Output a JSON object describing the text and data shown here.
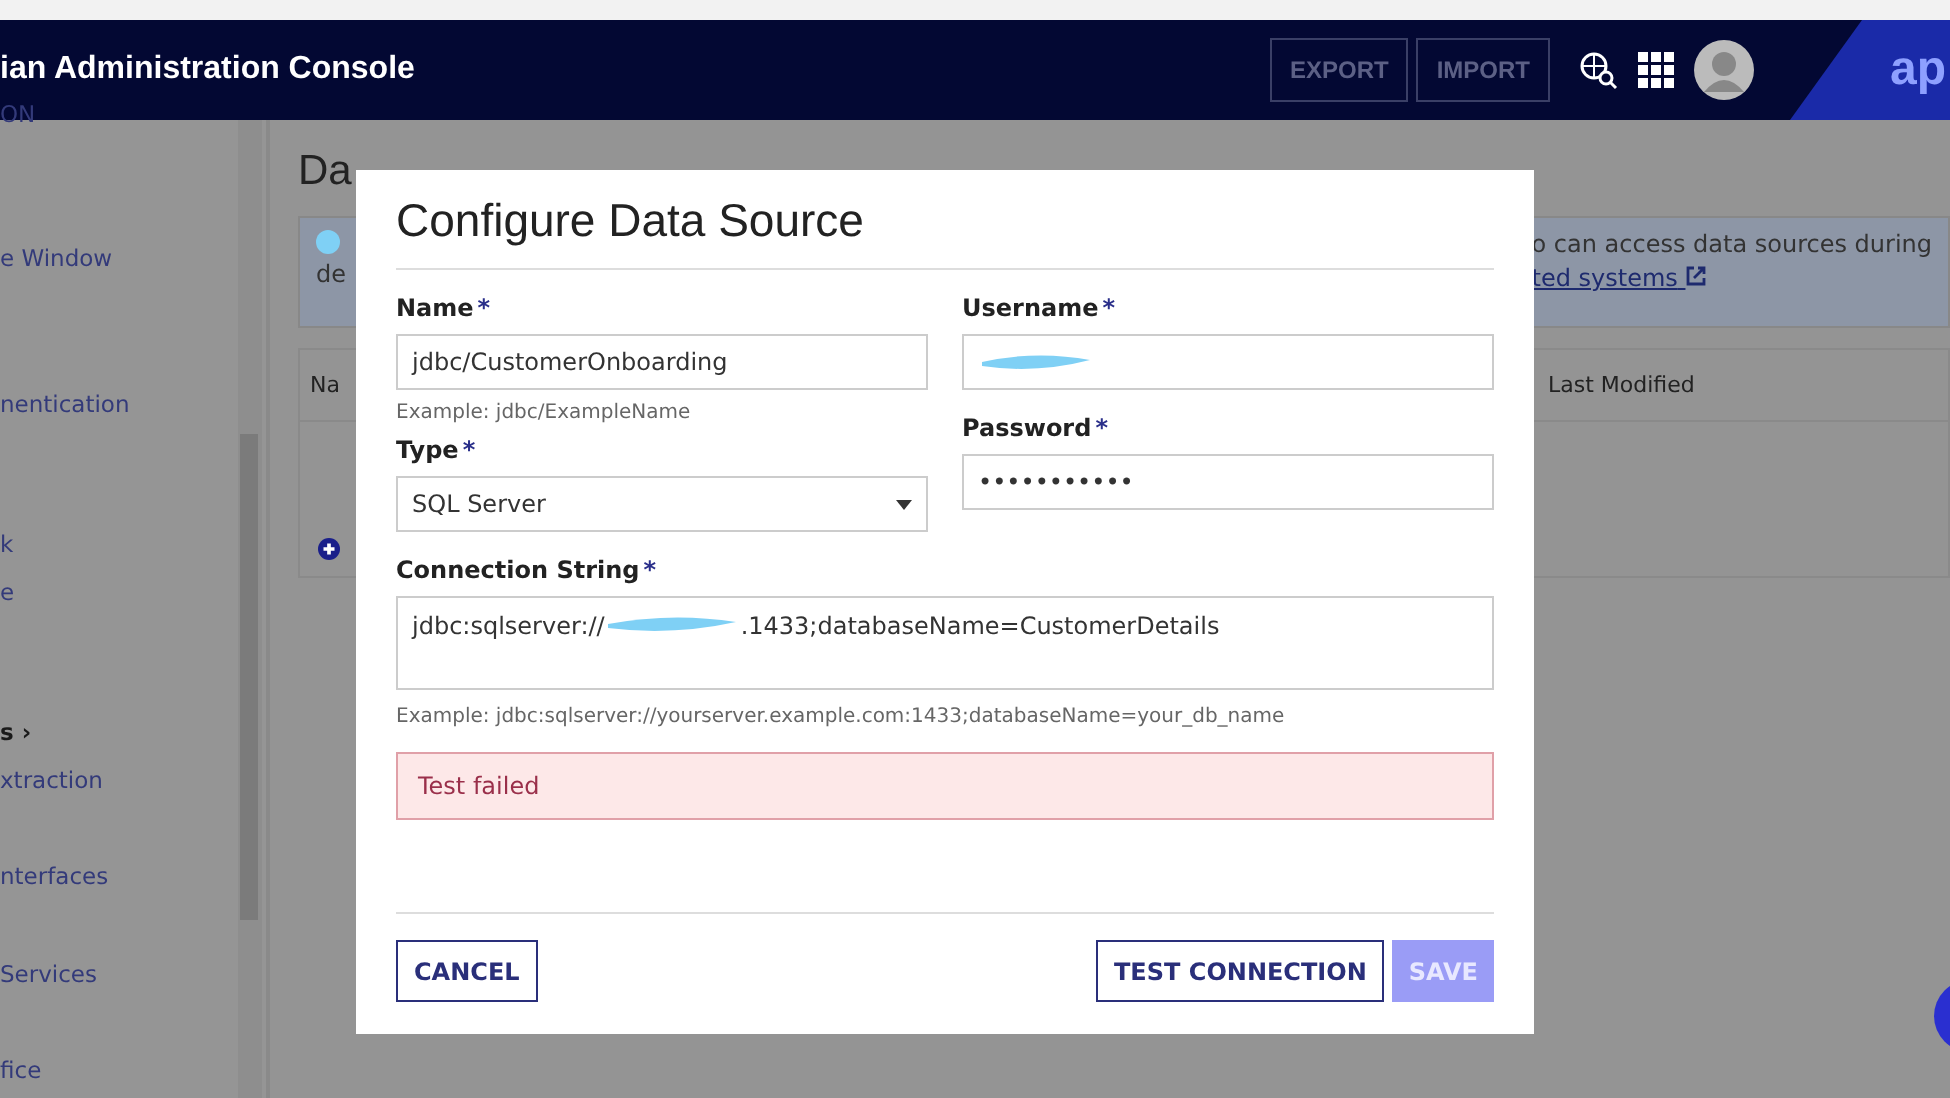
{
  "header": {
    "title": "ian Administration Console",
    "buttons": [
      "EXPORT",
      "IMPORT"
    ],
    "logo": "ap"
  },
  "sidebar": {
    "items": [
      {
        "label": "ON",
        "bold": false
      },
      {
        "label": "e Window",
        "bold": false
      },
      {
        "label": "nentication",
        "bold": false
      },
      {
        "label": "k",
        "bold": false
      },
      {
        "label": "e",
        "bold": false
      },
      {
        "label": "s ›",
        "bold": true
      },
      {
        "label": "xtraction",
        "bold": false
      },
      {
        "label": "nterfaces",
        "bold": false
      },
      {
        "label": "Services",
        "bold": false
      },
      {
        "label": "fice",
        "bold": false
      }
    ]
  },
  "page": {
    "title": "Da",
    "banner": {
      "left": "de",
      "right_line": "o can access data sources during",
      "link": "ted systems"
    },
    "table": {
      "columns": [
        "Na",
        "Last Modified"
      ]
    }
  },
  "dialog": {
    "title": "Configure Data Source",
    "fields": [
      {
        "label": "Name",
        "marker": "*",
        "value": "jdbc/CustomerOnboarding",
        "hint": "Example: jdbc/ExampleName"
      },
      {
        "label": "Type",
        "marker": "*",
        "value": "SQL Server"
      },
      {
        "label": "Username",
        "marker": "*",
        "redacted": true
      },
      {
        "label": "Password",
        "marker": "*",
        "value": "•••••••••••"
      }
    ],
    "connection": {
      "label": "Connection String",
      "marker": "*",
      "value_before": "jdbc:sqlserver://",
      "value_after": ".1433;databaseName=CustomerDetails",
      "hint": "Example: jdbc:sqlserver://yourserver.example.com:1433;databaseName=your_db_name"
    },
    "error": "Test failed",
    "buttons": [
      {
        "label": "CANCEL",
        "kind": "secondary",
        "disabled": false
      },
      {
        "label": "TEST CONNECTION",
        "kind": "secondary",
        "disabled": false
      },
      {
        "label": "SAVE",
        "kind": "primary",
        "disabled": true
      }
    ]
  }
}
